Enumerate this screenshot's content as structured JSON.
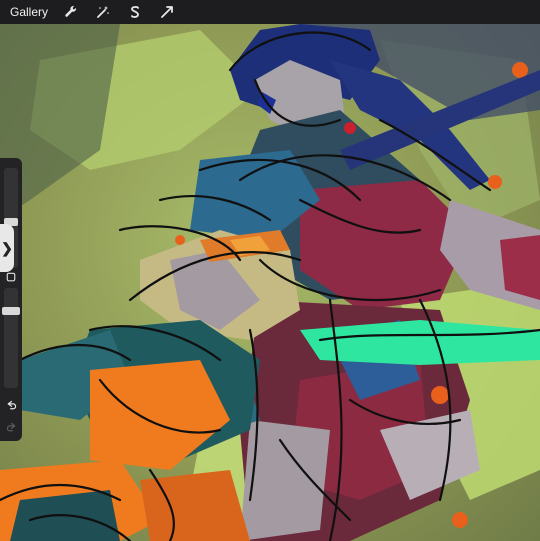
{
  "toolbar": {
    "gallery_label": "Gallery",
    "tools": [
      {
        "icon": "wrench-icon"
      },
      {
        "icon": "magic-wand-icon"
      },
      {
        "icon": "selection-s-icon"
      },
      {
        "icon": "arrow-cursor-icon"
      }
    ]
  },
  "sidebar": {
    "tab_glyph": "❯",
    "brush_size_level": 0.28,
    "opacity_level": 0.58,
    "undo_icon": "undo-icon",
    "redo_icon": "redo-icon",
    "modify_icon": "square-modify-icon"
  },
  "colors": {
    "toolbar_bg": "#1d1d1f",
    "sidebar_bg": "#232325",
    "canvas_bg": "#7d8a4c"
  }
}
